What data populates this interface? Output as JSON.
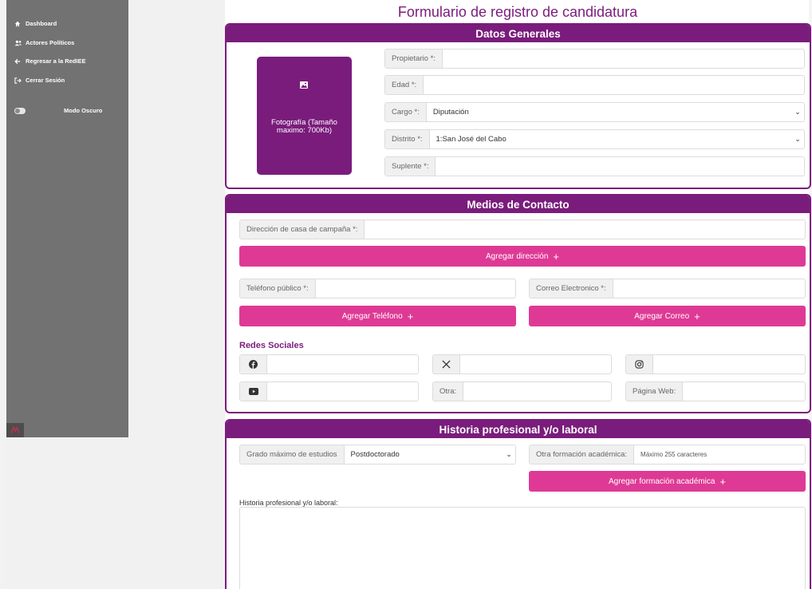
{
  "sidebar": {
    "items": [
      {
        "label": "Dashboard",
        "icon": "home-icon"
      },
      {
        "label": "Actores Políticos",
        "icon": "users-icon"
      },
      {
        "label": "Regresar a la RedIEE",
        "icon": "arrow-left-icon"
      },
      {
        "label": "Cerrar Sesión",
        "icon": "logout-icon"
      }
    ],
    "dark_mode_label": "Modo Oscuro"
  },
  "page_title": "Formulario de registro de candidatura",
  "datos_generales": {
    "title": "Datos Generales",
    "photo_caption": "Fotografía (Tamaño maximo: 700Kb)",
    "propietario_label": "Propietario *:",
    "edad_label": "Edad *:",
    "cargo_label": "Cargo *:",
    "cargo_value": "Diputación",
    "distrito_label": "Distrito *:",
    "distrito_value": "1:San José del Cabo",
    "suplente_label": "Suplente *:"
  },
  "medios_contacto": {
    "title": "Medios de Contacto",
    "direccion_label": "Dirección de casa de campaña *:",
    "agregar_direccion": "Agregar dirección",
    "telefono_label": "Teléfono público *:",
    "correo_label": "Correo Electronico *:",
    "agregar_telefono": "Agregar Teléfono",
    "agregar_correo": "Agregar Correo",
    "redes_title": "Redes Sociales",
    "otra_label": "Otra:",
    "pagina_web_label": "Página Web:"
  },
  "historia": {
    "title": "Historia profesional y/o laboral",
    "grado_label": "Grado máximo de estudios",
    "grado_value": "Postdoctorado",
    "otra_formacion_label": "Otra formación académica:",
    "otra_formacion_placeholder": "Máximo 255 caracteres",
    "agregar_formacion": "Agregar formación académica",
    "historia_label": "Historia profesional y/o laboral:"
  },
  "colors": {
    "primary": "#7a1c7c",
    "accent": "#de3a95",
    "sidebar": "#727272"
  }
}
